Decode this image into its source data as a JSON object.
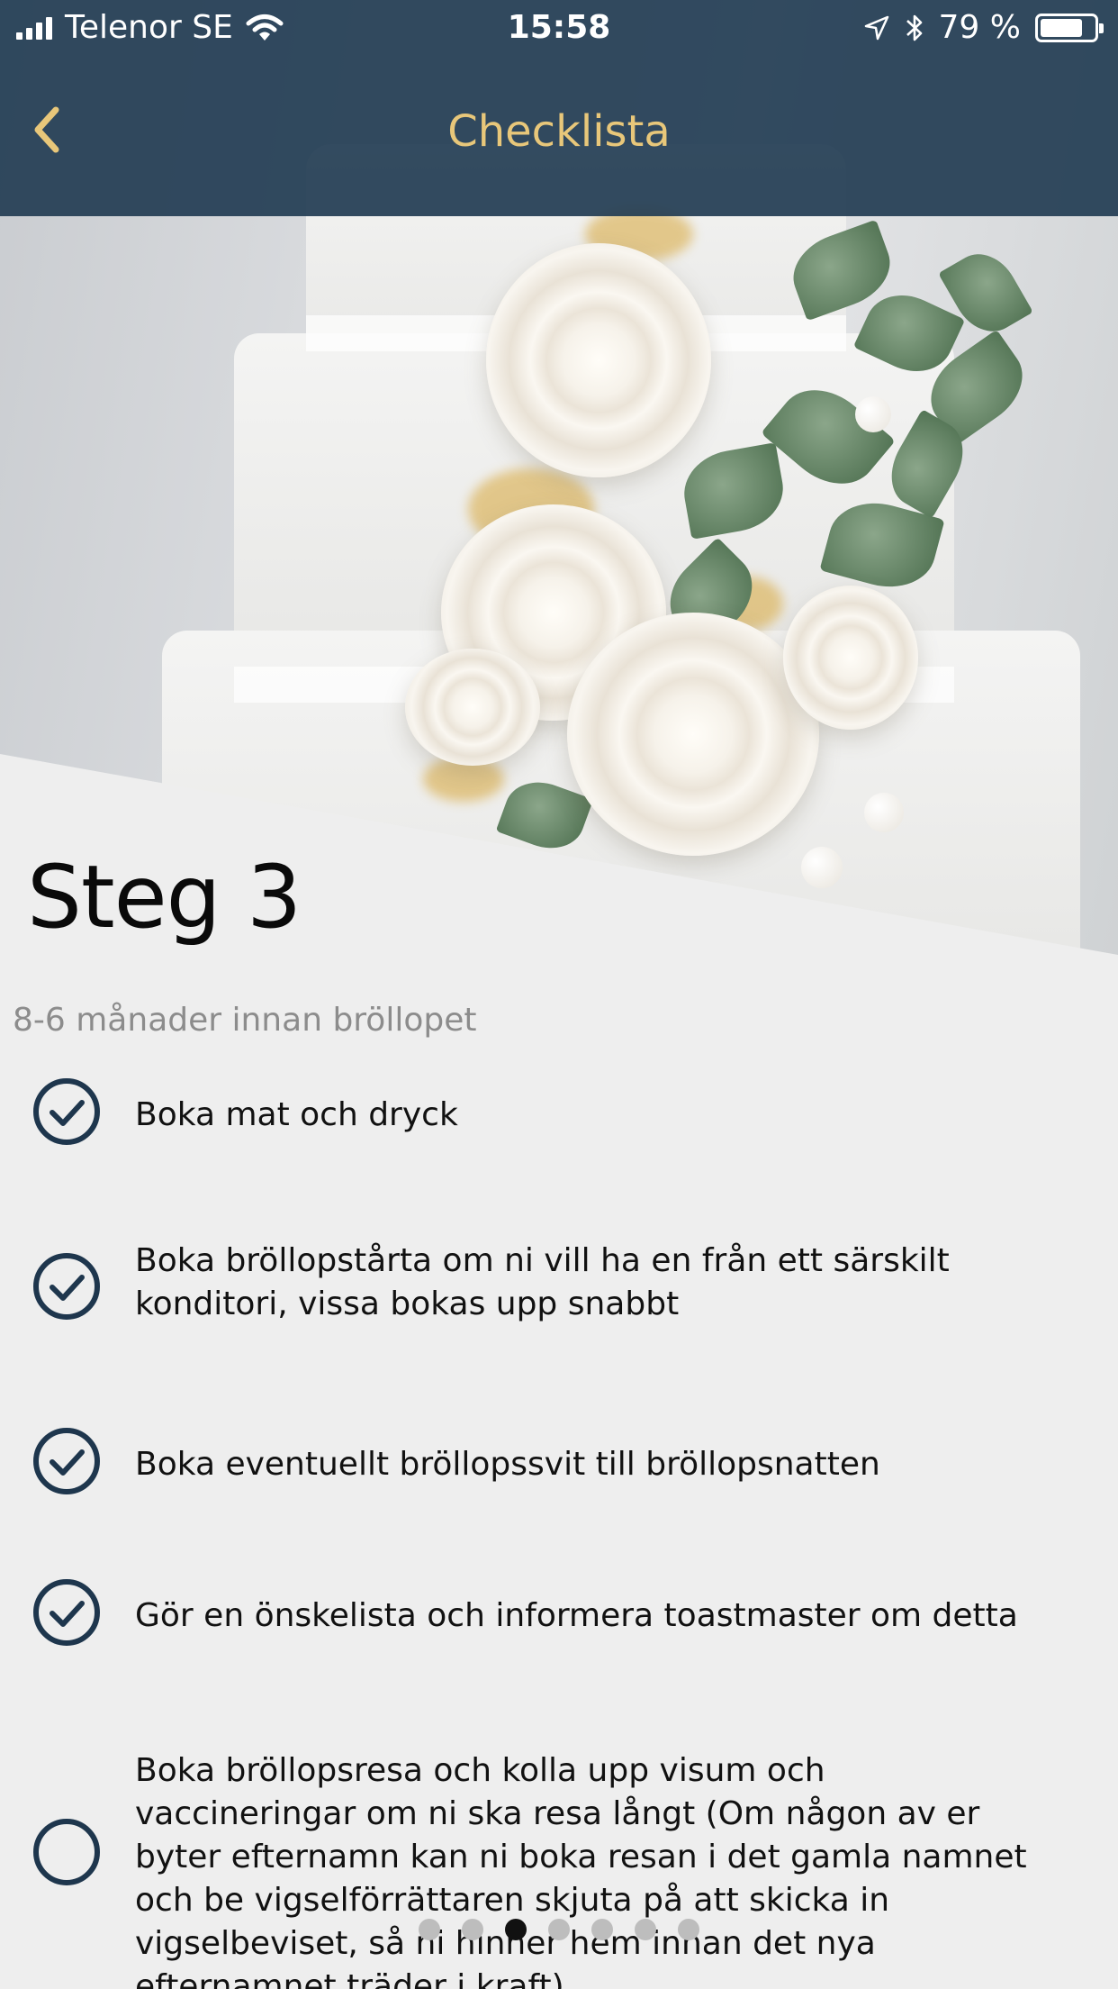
{
  "status_bar": {
    "carrier": "Telenor SE",
    "time": "15:58",
    "battery_percent": "79 %",
    "battery_level": 0.79,
    "icons": [
      "signal-icon",
      "wifi-icon",
      "location-icon",
      "bluetooth-icon",
      "battery-icon"
    ]
  },
  "nav": {
    "title": "Checklista",
    "back_icon": "chevron-left-icon"
  },
  "colors": {
    "nav_background": "#243d54",
    "accent_gold": "#e8c77a",
    "check_navy": "#1e364d",
    "background": "#eeeeee"
  },
  "step": {
    "title": "Steg 3",
    "subtitle": "8-6 månader innan bröllopet"
  },
  "checklist": [
    {
      "text": "Boka mat och dryck",
      "checked": true
    },
    {
      "text": "Boka bröllopstårta om ni vill ha en från ett särskilt konditori, vissa bokas upp snabbt",
      "checked": true
    },
    {
      "text": "Boka eventuellt bröllopssvit till bröllopsnatten",
      "checked": true
    },
    {
      "text": "Gör en önskelista och informera toastmaster om detta",
      "checked": true
    },
    {
      "text": "Boka bröllopsresa och kolla upp visum och vaccineringar om ni ska resa långt (Om någon av er byter efternamn kan ni boka resan i det gamla namnet och be vigselförrättaren skjuta på att skicka in vigselbeviset, så ni hinner hem innan det nya efternamnet träder i kraft)",
      "checked": false
    }
  ],
  "pager": {
    "total": 7,
    "active": 3
  }
}
